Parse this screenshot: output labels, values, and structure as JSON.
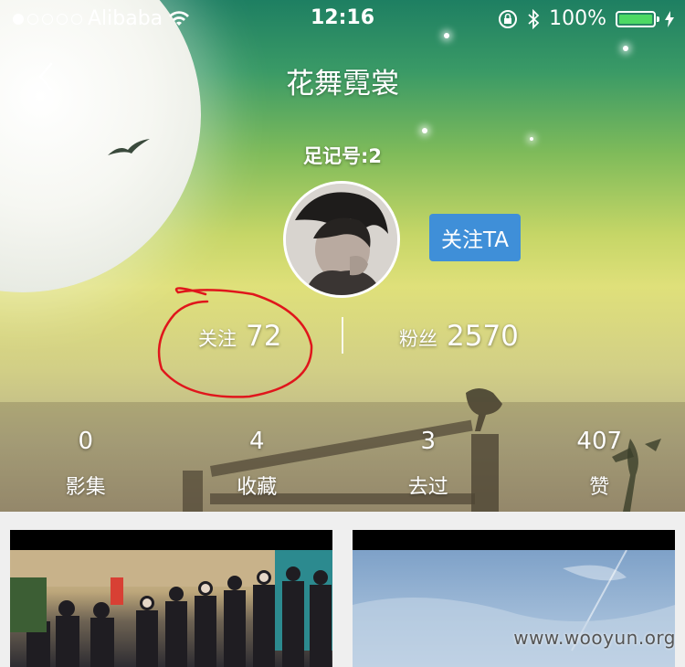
{
  "status_bar": {
    "carrier": "Alibaba",
    "time": "12:16",
    "battery": "100%",
    "battery_level": 1.0
  },
  "nav": {
    "title": "花舞霓裳"
  },
  "profile": {
    "id_label": "足记号:2",
    "follow_button": "关注TA",
    "following_label": "关注",
    "following_count": "72",
    "followers_label": "粉丝",
    "followers_count": "2570"
  },
  "counts": [
    {
      "value": "0",
      "label": "影集"
    },
    {
      "value": "4",
      "label": "收藏"
    },
    {
      "value": "3",
      "label": "去过"
    },
    {
      "value": "407",
      "label": "赞"
    }
  ],
  "watermark": "www.wooyun.org",
  "colors": {
    "follow_button": "#3f8fd8",
    "annotation": "#e0161c",
    "battery": "#4cd964"
  }
}
